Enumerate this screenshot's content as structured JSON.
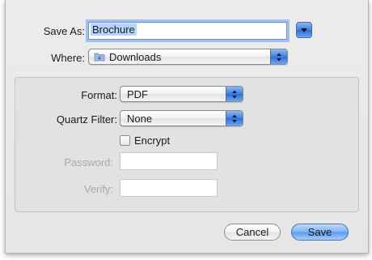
{
  "save_as": {
    "label": "Save As:",
    "value": "Brochure"
  },
  "where": {
    "label": "Where:",
    "value": "Downloads",
    "folder_icon": "downloads-folder-icon"
  },
  "options": {
    "format": {
      "label": "Format:",
      "value": "PDF"
    },
    "quartz_filter": {
      "label": "Quartz Filter:",
      "value": "None"
    },
    "encrypt": {
      "label": "Encrypt",
      "checked": false
    },
    "password": {
      "label": "Password:",
      "value": ""
    },
    "verify": {
      "label": "Verify:",
      "value": ""
    }
  },
  "buttons": {
    "cancel": "Cancel",
    "save": "Save"
  },
  "colors": {
    "accent": "#3f7fe0",
    "selection": "#b5d4fe",
    "focus_ring": "#9fc1ec"
  }
}
